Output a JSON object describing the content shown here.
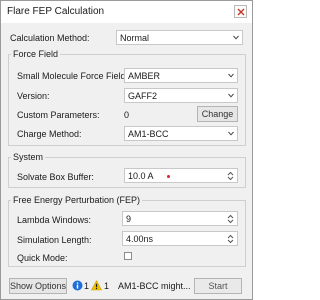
{
  "window": {
    "title": "Flare FEP Calculation"
  },
  "calculation": {
    "label": "Calculation Method:",
    "value": "Normal"
  },
  "force_field": {
    "group_title": "Force Field",
    "small_molecule": {
      "label": "Small Molecule Force Field:",
      "value": "AMBER"
    },
    "version": {
      "label": "Version:",
      "value": "GAFF2"
    },
    "custom_params": {
      "label": "Custom Parameters:",
      "value": "0",
      "button": "Change"
    },
    "charge_method": {
      "label": "Charge Method:",
      "value": "AM1-BCC"
    }
  },
  "system": {
    "group_title": "System",
    "solvate": {
      "label": "Solvate Box Buffer:",
      "value": "10.0 A"
    }
  },
  "fep": {
    "group_title": "Free Energy Perturbation (FEP)",
    "lambda": {
      "label": "Lambda Windows:",
      "value": "9"
    },
    "sim_length": {
      "label": "Simulation Length:",
      "value": "4.00ns"
    },
    "quick_mode": {
      "label": "Quick Mode:",
      "checked": false
    }
  },
  "footer": {
    "show_options": "Show Options",
    "info_count": "1",
    "warning_count": "1",
    "status_message": "AM1-BCC might...",
    "start": "Start"
  },
  "colors": {
    "info": "#1e6fd9",
    "warning": "#f2c200",
    "required": "#e0202a",
    "close_x": "#c0392b"
  }
}
